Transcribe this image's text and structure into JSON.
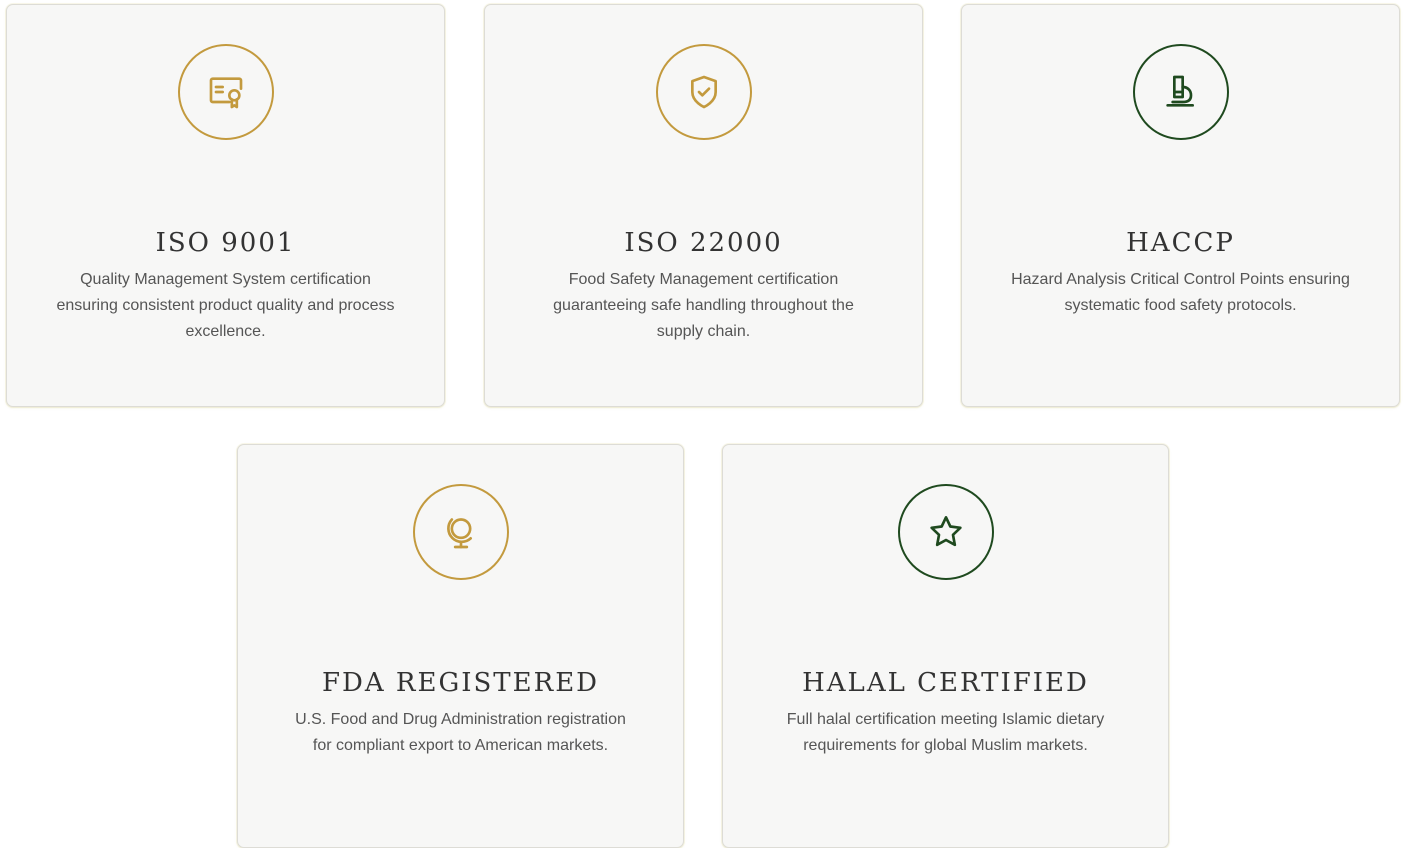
{
  "colors": {
    "gold": "#c39a3e",
    "green": "#1f4a1f",
    "card_background": "#f7f7f6",
    "title_text": "#333333",
    "body_text": "#555555"
  },
  "certifications": [
    {
      "title": "ISO 9001",
      "description": "Quality Management System certification ensuring consistent product quality and process excellence.",
      "icon": "certificate-icon",
      "icon_color": "gold"
    },
    {
      "title": "ISO 22000",
      "description": "Food Safety Management certification guaranteeing safe handling throughout the supply chain.",
      "icon": "shield-check-icon",
      "icon_color": "gold"
    },
    {
      "title": "HACCP",
      "description": "Hazard Analysis Critical Control Points ensuring systematic food safety protocols.",
      "icon": "microscope-icon",
      "icon_color": "green"
    },
    {
      "title": "FDA REGISTERED",
      "description": "U.S. Food and Drug Administration registration for compliant export to American markets.",
      "icon": "globe-icon",
      "icon_color": "gold"
    },
    {
      "title": "HALAL CERTIFIED",
      "description": "Full halal certification meeting Islamic dietary requirements for global Muslim markets.",
      "icon": "star-icon",
      "icon_color": "green"
    }
  ]
}
